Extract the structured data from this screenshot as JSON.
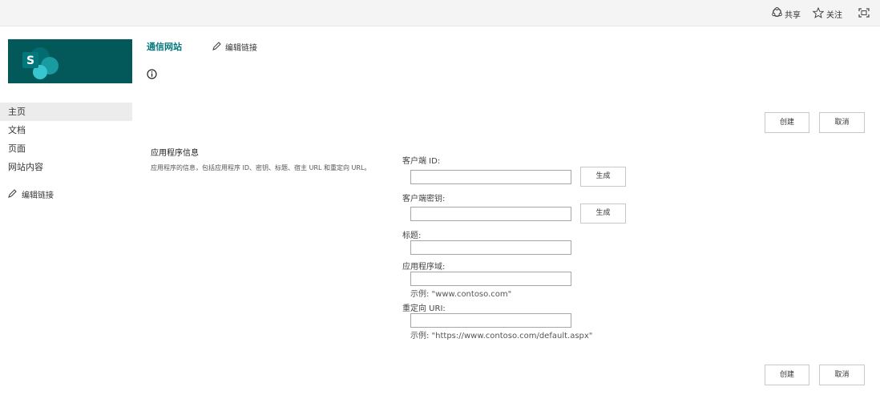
{
  "topbar": {
    "share_label": "共享",
    "follow_label": "关注"
  },
  "header": {
    "site_title": "通信网站",
    "edit_links_label": "编辑链接",
    "logo_letter": "S"
  },
  "nav": {
    "items": [
      {
        "label": "主页",
        "active": true
      },
      {
        "label": "文档",
        "active": false
      },
      {
        "label": "页面",
        "active": false
      },
      {
        "label": "网站内容",
        "active": false
      }
    ],
    "edit_links_label": "编辑链接"
  },
  "actions": {
    "create_label": "创建",
    "cancel_label": "取消"
  },
  "form": {
    "section_title": "应用程序信息",
    "section_description": "应用程序的信息，包括应用程序 ID、密钥、标题、宿主 URL 和重定向 URL。",
    "client_id": {
      "label": "客户端 ID:",
      "value": "",
      "generate_label": "生成"
    },
    "client_secret": {
      "label": "客户端密钥:",
      "value": "",
      "generate_label": "生成"
    },
    "title": {
      "label": "标题:",
      "value": ""
    },
    "app_domain": {
      "label": "应用程序域:",
      "value": "",
      "hint": "示例: \"www.contoso.com\""
    },
    "redirect_uri": {
      "label": "重定向 URI:",
      "value": "",
      "hint": "示例: \"https://www.contoso.com/default.aspx\""
    }
  },
  "colors": {
    "brand": "#03585a",
    "link": "#03787c",
    "topbar": "#f4f4f4"
  },
  "icons": {
    "share": "share-icon",
    "follow": "star-icon",
    "fullscreen": "fullscreen-icon",
    "edit": "pencil-icon",
    "info": "info-icon",
    "logo": "sharepoint-logo-icon"
  }
}
